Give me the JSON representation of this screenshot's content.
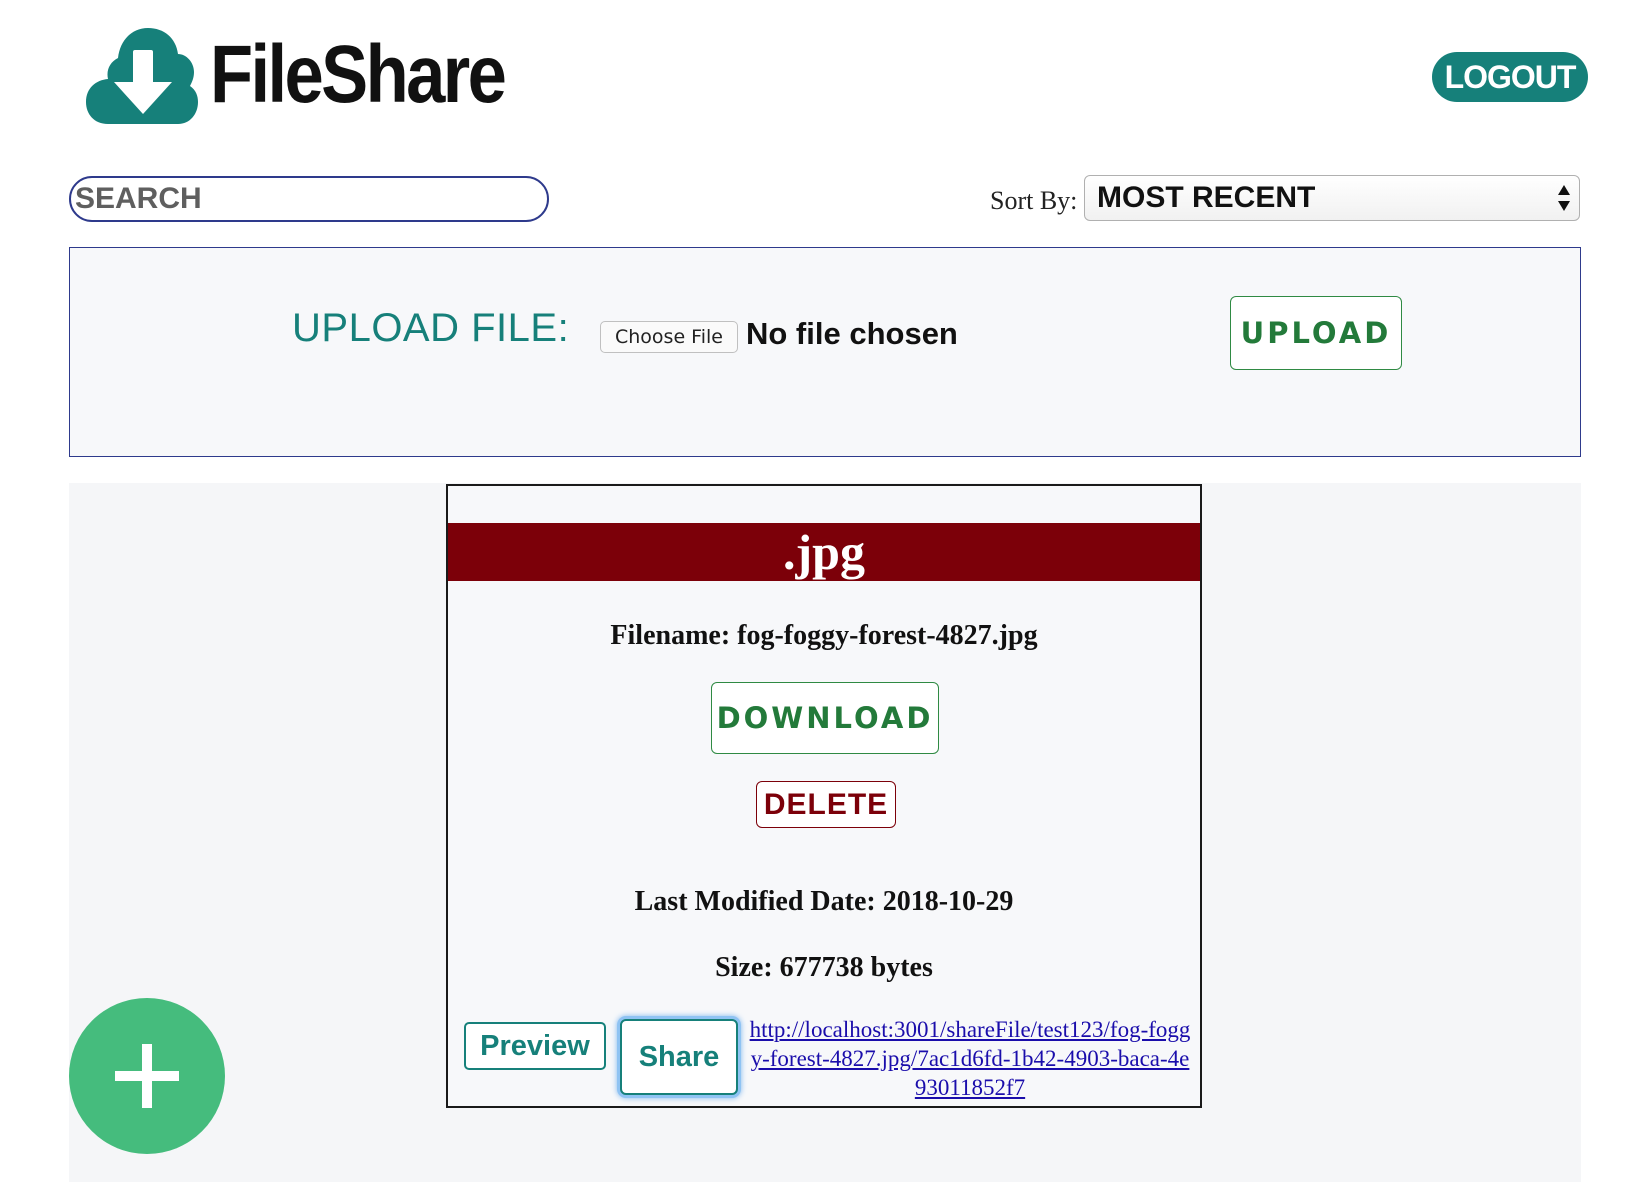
{
  "app": {
    "name": "FileShare",
    "logo_icon": "cloud-download-icon",
    "accent_color": "#16807a"
  },
  "header": {
    "logout_label": "LOGOUT"
  },
  "toolbar": {
    "search_placeholder": "SEARCH",
    "sort_label": "Sort By:",
    "sort_value": "MOST RECENT"
  },
  "upload": {
    "label": "UPLOAD FILE:",
    "choose_file_label": "Choose File",
    "no_file_text": "No file chosen",
    "upload_button_label": "UPLOAD"
  },
  "files": [
    {
      "extension": ".jpg",
      "filename_text": "Filename: fog-foggy-forest-4827.jpg",
      "download_label": "DOWNLOAD",
      "delete_label": "DELETE",
      "modified_text": "Last Modified Date: 2018-10-29",
      "size_text": "Size: 677738 bytes",
      "preview_label": "Preview",
      "share_label": "Share",
      "share_link": "http://localhost:3001/shareFile/test123/fog-foggy-forest-4827.jpg/7ac1d6fd-1b42-4903-baca-4e93011852f7",
      "header_color": "#7c0009"
    }
  ],
  "fab": {
    "icon": "plus-icon",
    "color": "#45bc7d"
  }
}
